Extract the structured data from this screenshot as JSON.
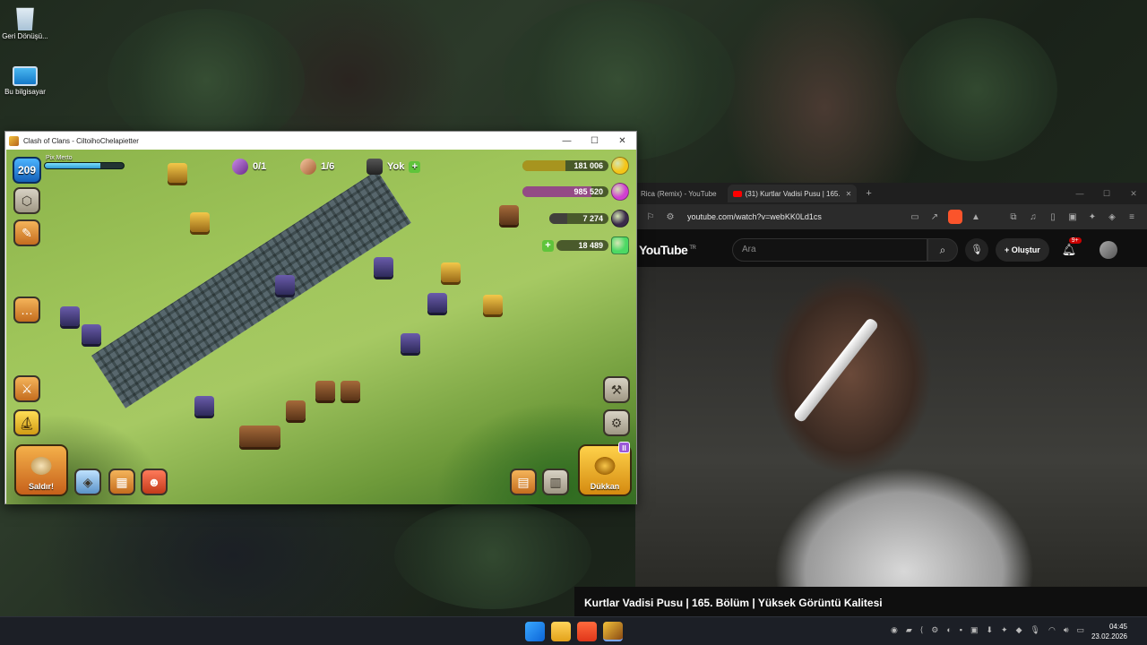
{
  "desktop": {
    "icons": [
      {
        "label": "Geri Dönüşü...",
        "icon": "recycle-bin-icon"
      },
      {
        "label": "Bu bilgisayar",
        "icon": "this-pc-icon"
      }
    ]
  },
  "coc_window": {
    "title": "Clash of Clans - CiltoihoChelapietter",
    "controls": {
      "minimize": "—",
      "maximize": "☐",
      "close": "✕"
    },
    "hud": {
      "level": "209",
      "player_name": "Pix Merto",
      "xp_fraction": 0.7,
      "builder_count": "0/1",
      "troop_count": "1/6",
      "shield": "Yok",
      "resources": [
        {
          "name": "gold",
          "value": "181 006",
          "color": "#f5c518",
          "fill": 0.5
        },
        {
          "name": "elixir",
          "value": "985 520",
          "color": "#d13fd1",
          "fill": 0.8
        },
        {
          "name": "dark-elixir",
          "value": "7 274",
          "color": "#3a2a4a",
          "fill": 0.3
        },
        {
          "name": "gems",
          "value": "18 489",
          "color": "#4cd964",
          "fill": 0
        }
      ]
    },
    "buttons": {
      "attack": "Saldır!",
      "shop": "Dükkan",
      "shop_badge": "II"
    }
  },
  "browser": {
    "tabs": [
      {
        "label": "Rica (Remix) - YouTube",
        "active": false
      },
      {
        "label": "(31) Kurtlar Vadisi Pusu | 165.",
        "active": true
      }
    ],
    "new_tab": "+",
    "url": "youtube.com/watch?v=webKK0Ld1cs",
    "youtube": {
      "logo": "YouTube",
      "region": "TR",
      "search_placeholder": "Ara",
      "create_label": "Oluştur",
      "notification_count": "9+"
    },
    "video_title": "Kurtlar Vadisi Pusu | 165. Bölüm | Yüksek Görüntü Kalitesi"
  },
  "taskbar": {
    "apps": [
      "start",
      "file-explorer",
      "brave",
      "clash-of-clans"
    ],
    "time": "04:45",
    "date": "23.02.2026"
  }
}
